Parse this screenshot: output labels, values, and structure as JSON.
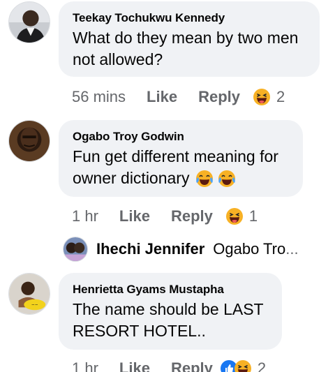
{
  "comments": [
    {
      "author": "Teekay Tochukwu Kennedy",
      "text_lines": [
        "What do they mean by two men",
        "not allowed?"
      ],
      "time": "56 mins",
      "like_label": "Like",
      "reply_label": "Reply",
      "reaction_icons": [
        "haha-icon"
      ],
      "reaction_count": "2"
    },
    {
      "author": "Ogabo Troy Godwin",
      "text_lines": [
        "Fun get different meaning for",
        "owner dictionary"
      ],
      "trailing_emojis": [
        "tears-of-joy-icon",
        "tears-of-joy-icon"
      ],
      "time": "1 hr",
      "like_label": "Like",
      "reply_label": "Reply",
      "reaction_icons": [
        "haha-icon"
      ],
      "reaction_count": "1"
    },
    {
      "author": "Henrietta Gyams Mustapha",
      "text_lines": [
        "The name should be LAST",
        "RESORT HOTEL.."
      ],
      "time": "1 hr",
      "like_label": "Like",
      "reply_label": "Reply",
      "reaction_icons": [
        "like-icon",
        "haha-icon"
      ],
      "reaction_count": "2"
    }
  ],
  "reply_preview": {
    "name": "Ihechi Jennifer",
    "snippet": "Ogabo Tro",
    "ellipsis": "..."
  },
  "colors": {
    "bubble": "#f0f2f5",
    "meta_text": "#65676b",
    "like_blue": "#1877f2",
    "emoji_yellow": "#f7b125"
  }
}
